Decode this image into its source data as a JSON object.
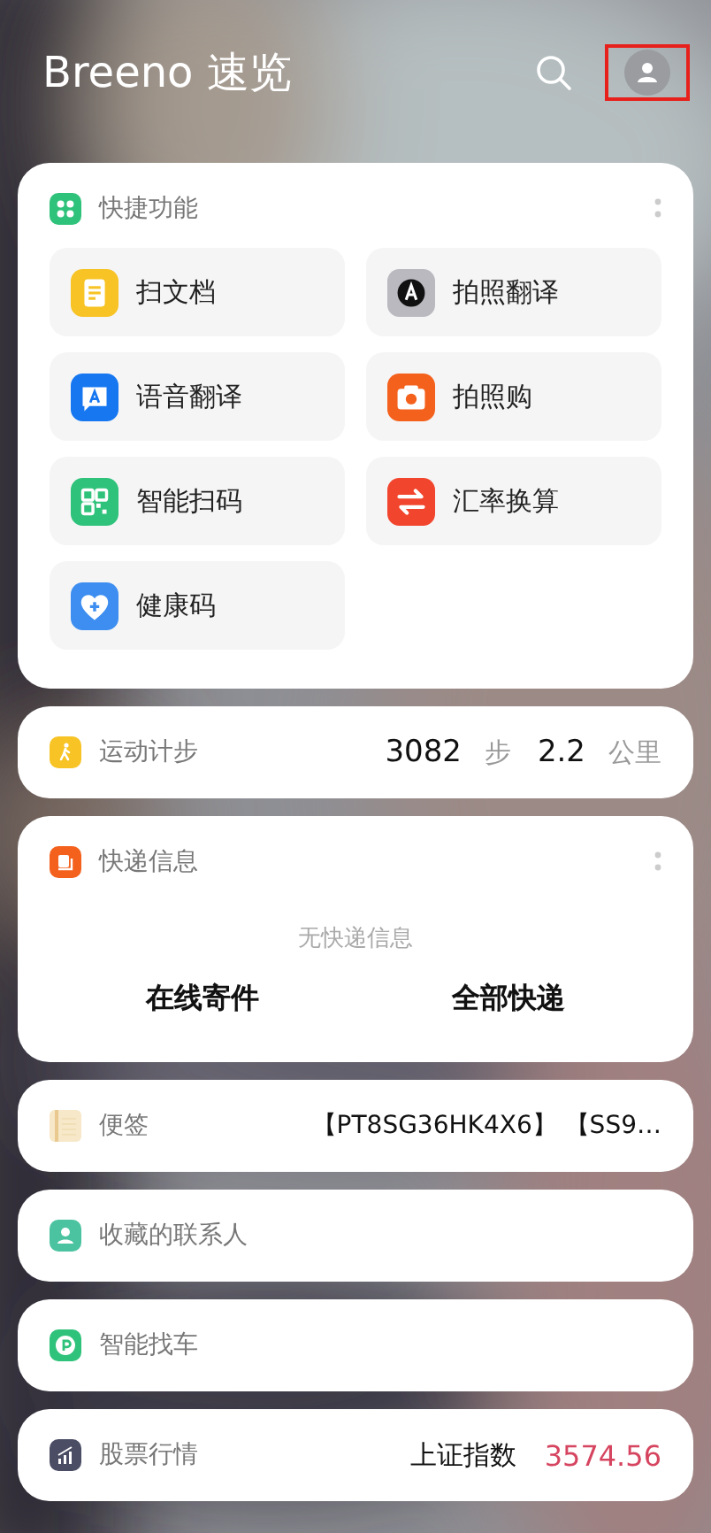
{
  "header": {
    "title": "Breeno 速览",
    "profile_highlighted": true
  },
  "cards": [
    {
      "kind": "grid",
      "title": "快捷功能",
      "menu": true,
      "items": [
        {
          "label": "扫文档"
        },
        {
          "label": "拍照翻译"
        },
        {
          "label": "语音翻译"
        },
        {
          "label": "拍照购"
        },
        {
          "label": "智能扫码"
        },
        {
          "label": "汇率换算"
        },
        {
          "label": "健康码"
        }
      ]
    },
    {
      "kind": "steps",
      "title": "运动计步",
      "steps": "3082",
      "steps_unit": "步",
      "distance": "2.2",
      "distance_unit": "公里"
    },
    {
      "kind": "express",
      "title": "快递信息",
      "menu": true,
      "empty": "无快递信息",
      "actions": [
        "在线寄件",
        "全部快递"
      ]
    },
    {
      "kind": "note",
      "title": "便签",
      "value": "【PT8SG36HK4X6】 【SS9…"
    },
    {
      "kind": "contacts",
      "title": "收藏的联系人"
    },
    {
      "kind": "car",
      "title": "智能找车"
    },
    {
      "kind": "stock",
      "title": "股票行情",
      "index_name": "上证指数",
      "index_value": "3574.56"
    }
  ]
}
